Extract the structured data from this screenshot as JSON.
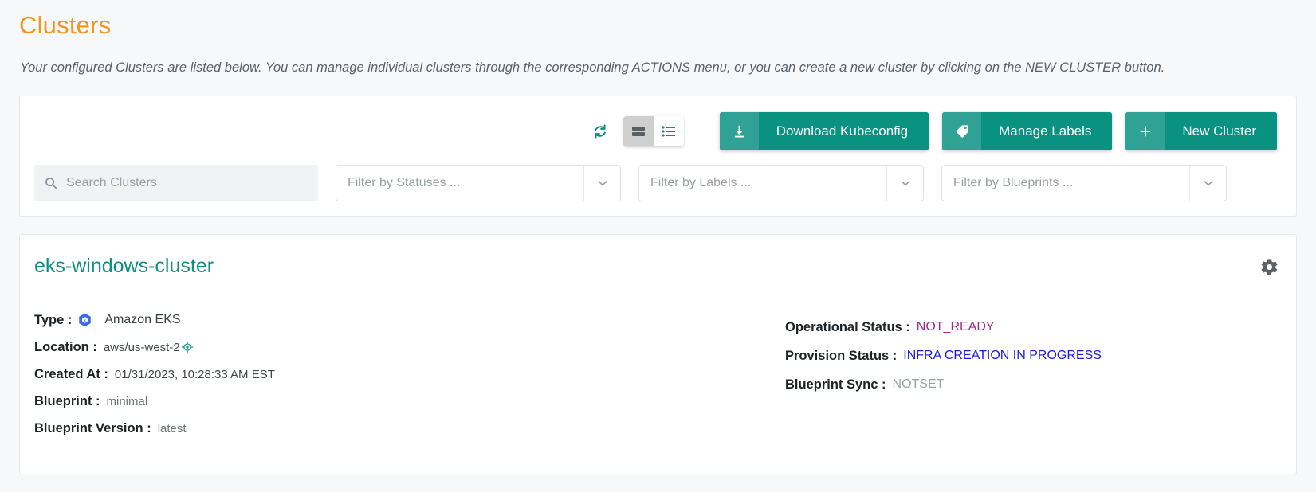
{
  "header": {
    "title": "Clusters",
    "description": "Your configured Clusters are listed below. You can manage individual clusters through the corresponding ACTIONS menu, or you can create a new cluster by clicking on the NEW CLUSTER button."
  },
  "toolbar": {
    "refresh_icon": "refresh-icon",
    "view_toggle": {
      "card_view_icon": "card-view-icon",
      "list_view_icon": "list-view-icon",
      "active": "card"
    },
    "buttons": [
      {
        "label": "Download Kubeconfig",
        "icon": "download-icon"
      },
      {
        "label": "Manage Labels",
        "icon": "tag-icon"
      },
      {
        "label": "New Cluster",
        "icon": "plus-icon"
      }
    ]
  },
  "filters": {
    "search_placeholder": "Search Clusters",
    "statuses": "Filter by Statuses ...",
    "labels": "Filter by Labels ...",
    "blueprints": "Filter by Blueprints ..."
  },
  "cluster": {
    "name": "eks-windows-cluster",
    "settings_icon": "gear-icon",
    "left": [
      {
        "label": "Type :",
        "value": "Amazon EKS",
        "icon": "kubernetes-icon"
      },
      {
        "label": "Location :",
        "value": "aws/us-west-2",
        "icon": "location-target-icon"
      },
      {
        "label": "Created At :",
        "value": "01/31/2023, 10:28:33 AM EST"
      },
      {
        "label": "Blueprint :",
        "value": "minimal"
      },
      {
        "label": "Blueprint Version :",
        "value": "latest"
      }
    ],
    "right": [
      {
        "label": "Operational Status :",
        "value": "NOT_READY",
        "state": "notready"
      },
      {
        "label": "Provision Status :",
        "value": "INFRA CREATION IN PROGRESS",
        "state": "infra"
      },
      {
        "label": "Blueprint Sync :",
        "value": "NOTSET",
        "state": "notset"
      }
    ]
  },
  "colors": {
    "title_orange": "#f5941d",
    "accent_teal": "#0a9281",
    "link_teal": "#0f8f82",
    "status_notready": "#a12a8e",
    "status_infra": "#1a1ae8",
    "status_notset": "#9aa0a6",
    "page_bg": "#f7f8fa"
  }
}
